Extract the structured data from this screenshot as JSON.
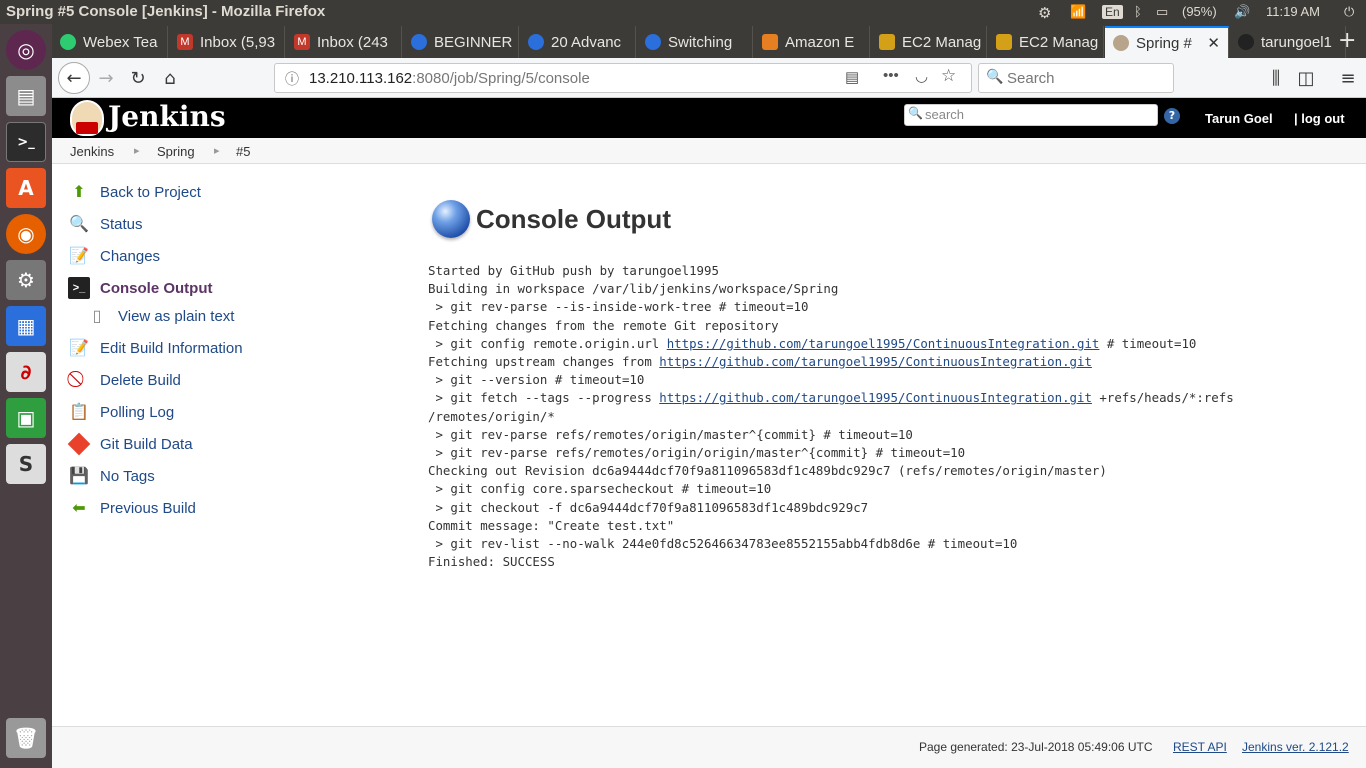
{
  "os": {
    "window_title": "Spring #5 Console [Jenkins] - Mozilla Firefox",
    "language": "En",
    "battery": "(95%)",
    "time": "11:19 AM"
  },
  "browser": {
    "tabs": [
      {
        "label": "Webex Tea",
        "icon": "webex-icon",
        "color": "#2ecc71"
      },
      {
        "label": "Inbox (5,93",
        "icon": "gmail-icon",
        "color": "#c0392b"
      },
      {
        "label": "Inbox (243",
        "icon": "gmail-icon",
        "color": "#c0392b"
      },
      {
        "label": "BEGINNER",
        "icon": "page-icon",
        "color": "#2a6fdb"
      },
      {
        "label": "20 Advanc",
        "icon": "page-icon",
        "color": "#2a6fdb"
      },
      {
        "label": "Switching",
        "icon": "page-icon",
        "color": "#2a6fdb"
      },
      {
        "label": "Amazon E",
        "icon": "aws-icon",
        "color": "#e67e22"
      },
      {
        "label": "EC2 Manag",
        "icon": "aws-icon",
        "color": "#d4a017"
      },
      {
        "label": "EC2 Manag",
        "icon": "aws-icon",
        "color": "#d4a017"
      },
      {
        "label": "Spring #",
        "icon": "jenkins-icon",
        "color": "#b8a48a",
        "active": true
      },
      {
        "label": "tarungoel1",
        "icon": "github-icon",
        "color": "#222222"
      }
    ],
    "url_host": "13.210.113.162",
    "url_rest": ":8080/job/Spring/5/console",
    "search_placeholder": "Search"
  },
  "jenkins": {
    "logo_text": "Jenkins",
    "search_placeholder": "search",
    "help": "?",
    "user": "Tarun Goel",
    "logout": "| log out",
    "breadcrumb": [
      "Jenkins",
      "Spring",
      "#5"
    ],
    "sidebar": [
      {
        "label": "Back to Project",
        "icon": "up-arrow-icon"
      },
      {
        "label": "Status",
        "icon": "magnifier-icon"
      },
      {
        "label": "Changes",
        "icon": "notepad-icon"
      },
      {
        "label": "Console Output",
        "icon": "terminal-icon",
        "current": true
      },
      {
        "label": "View as plain text",
        "icon": "document-icon",
        "sub": true
      },
      {
        "label": "Edit Build Information",
        "icon": "notepad-icon"
      },
      {
        "label": "Delete Build",
        "icon": "no-entry-icon"
      },
      {
        "label": "Polling Log",
        "icon": "clipboard-icon"
      },
      {
        "label": "Git Build Data",
        "icon": "git-icon"
      },
      {
        "label": "No Tags",
        "icon": "floppy-icon"
      },
      {
        "label": "Previous Build",
        "icon": "left-arrow-icon"
      }
    ],
    "title": "Console Output",
    "console_lines": [
      {
        "text": "Started by GitHub push by tarungoel1995"
      },
      {
        "text": "Building in workspace /var/lib/jenkins/workspace/Spring"
      },
      {
        "text": " > git rev-parse --is-inside-work-tree # timeout=10"
      },
      {
        "text": "Fetching changes from the remote Git repository"
      },
      {
        "text": " > git config remote.origin.url ",
        "link": "https://github.com/tarungoel1995/ContinuousIntegration.git",
        "after": " # timeout=10"
      },
      {
        "text": "Fetching upstream changes from ",
        "link": "https://github.com/tarungoel1995/ContinuousIntegration.git",
        "after": ""
      },
      {
        "text": " > git --version # timeout=10"
      },
      {
        "text": " > git fetch --tags --progress ",
        "link": "https://github.com/tarungoel1995/ContinuousIntegration.git",
        "after": " +refs/heads/*:refs"
      },
      {
        "text": "/remotes/origin/*"
      },
      {
        "text": " > git rev-parse refs/remotes/origin/master^{commit} # timeout=10"
      },
      {
        "text": " > git rev-parse refs/remotes/origin/origin/master^{commit} # timeout=10"
      },
      {
        "text": "Checking out Revision dc6a9444dcf70f9a811096583df1c489bdc929c7 (refs/remotes/origin/master)"
      },
      {
        "text": " > git config core.sparsecheckout # timeout=10"
      },
      {
        "text": " > git checkout -f dc6a9444dcf70f9a811096583df1c489bdc929c7"
      },
      {
        "text": "Commit message: \"Create test.txt\""
      },
      {
        "text": " > git rev-list --no-walk 244e0fd8c52646634783ee8552155abb4fdb8d6e # timeout=10"
      },
      {
        "text": "Finished: SUCCESS"
      }
    ],
    "footer": {
      "generated": "Page generated: 23-Jul-2018 05:49:06 UTC",
      "rest_api": "REST API",
      "version": "Jenkins ver. 2.121.2"
    }
  }
}
